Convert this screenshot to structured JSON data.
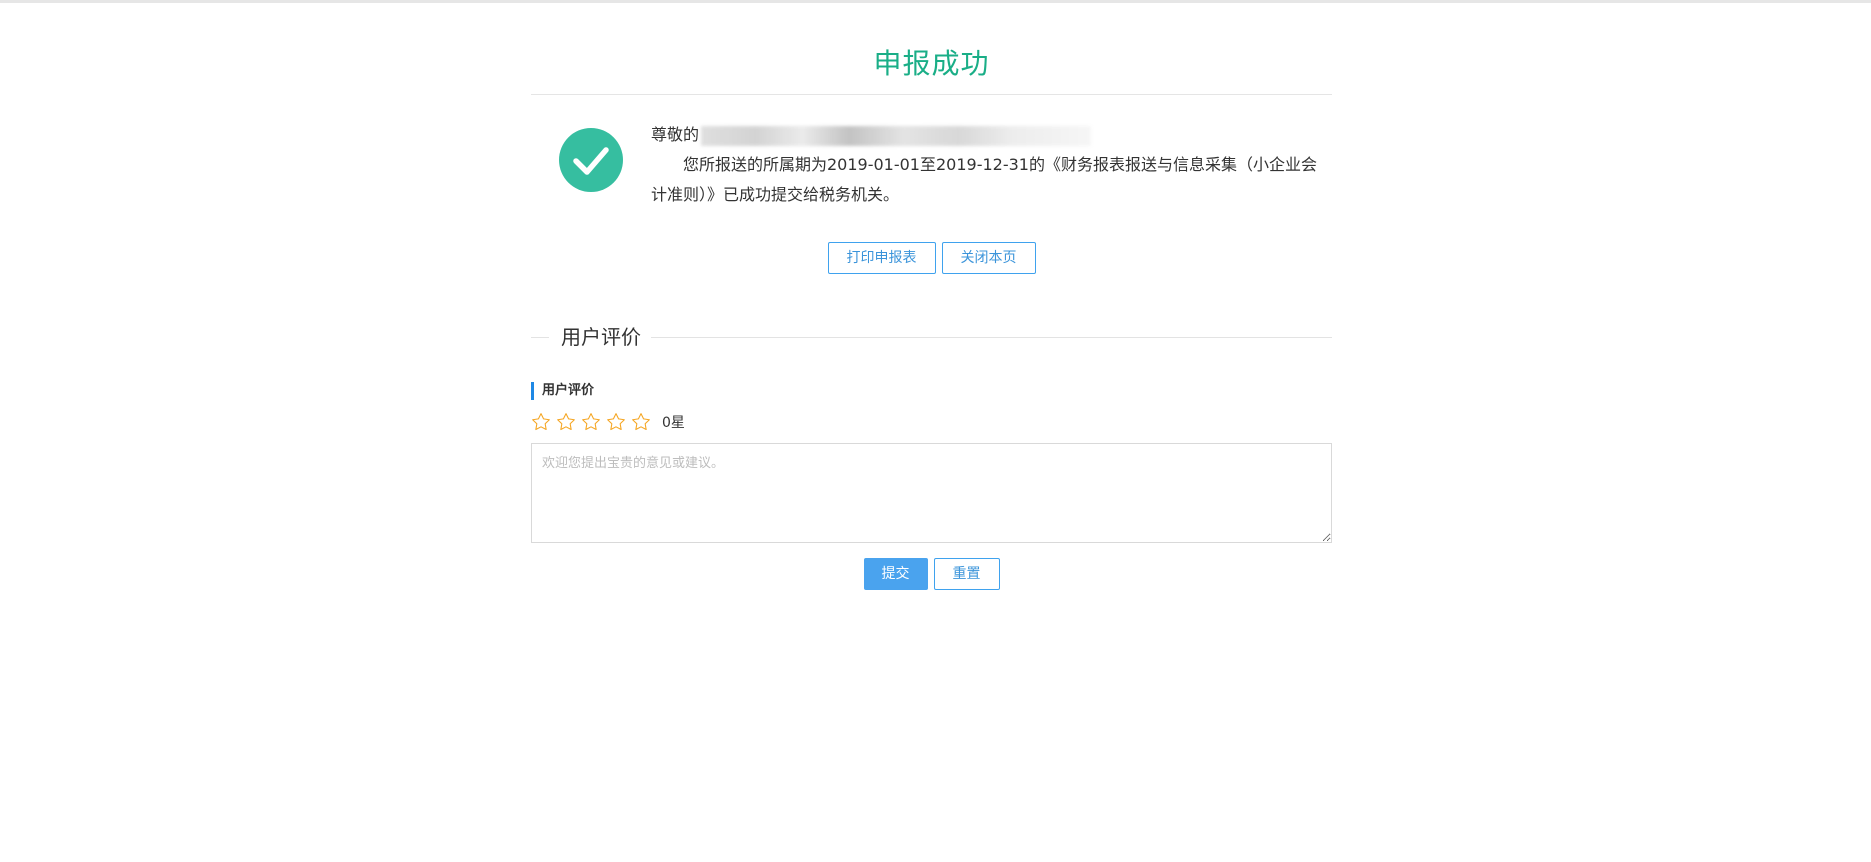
{
  "header": {
    "title": "申报成功"
  },
  "message": {
    "greeting": "尊敬的",
    "body": "您所报送的所属期为2019-01-01至2019-12-31的《财务报表报送与信息采集（小企业会计准则）》已成功提交给税务机关。",
    "icon": "check-circle-icon",
    "icon_color": "#36bea0"
  },
  "actions": {
    "print_label": "打印申报表",
    "close_label": "关闭本页"
  },
  "evaluation": {
    "section_title": "用户评价",
    "label": "用户评价",
    "rating": 0,
    "rating_max": 5,
    "rating_text": "0星",
    "star_color": "#f5a623",
    "placeholder": "欢迎您提出宝贵的意见或建议。",
    "submit_label": "提交",
    "reset_label": "重置"
  },
  "colors": {
    "title": "#1aae87",
    "accent": "#3fa2ee",
    "primary_button": "#4aa3ee"
  }
}
